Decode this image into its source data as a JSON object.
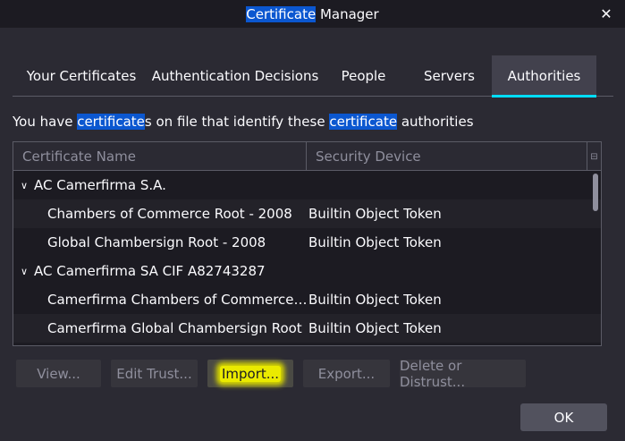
{
  "window": {
    "title_highlight": "Certificate",
    "title_rest": " Manager",
    "close_icon": "close-icon"
  },
  "tabs": [
    {
      "label": "Your Certificates",
      "selected": false
    },
    {
      "label": "Authentication Decisions",
      "selected": false
    },
    {
      "label": "People",
      "selected": false
    },
    {
      "label": "Servers",
      "selected": false
    },
    {
      "label": "Authorities",
      "selected": true
    }
  ],
  "description": {
    "part1": "You have ",
    "hl1": "certificate",
    "part2": "s on file that identify these ",
    "hl2": "certificate",
    "part3": " authorities"
  },
  "table": {
    "columns": [
      "Certificate Name",
      "Security Device"
    ],
    "rows": [
      {
        "type": "group",
        "name": "AC Camerfirma S.A.",
        "device": ""
      },
      {
        "type": "child",
        "name": "Chambers of Commerce Root - 2008",
        "device": "Builtin Object Token"
      },
      {
        "type": "child",
        "name": "Global Chambersign Root - 2008",
        "device": "Builtin Object Token"
      },
      {
        "type": "group",
        "name": "AC Camerfirma SA CIF A82743287",
        "device": ""
      },
      {
        "type": "child",
        "name": "Camerfirma Chambers of Commerce Ro...",
        "device": "Builtin Object Token"
      },
      {
        "type": "child",
        "name": "Camerfirma Global Chambersign Root",
        "device": "Builtin Object Token"
      }
    ]
  },
  "buttons": {
    "view": "View...",
    "edit_trust": "Edit Trust...",
    "import": "Import...",
    "export": "Export...",
    "delete": "Delete or Distrust...",
    "ok": "OK"
  },
  "colors": {
    "accent": "#00ddff",
    "highlight": "#0b57d0",
    "import_highlight": "#eaea00"
  }
}
